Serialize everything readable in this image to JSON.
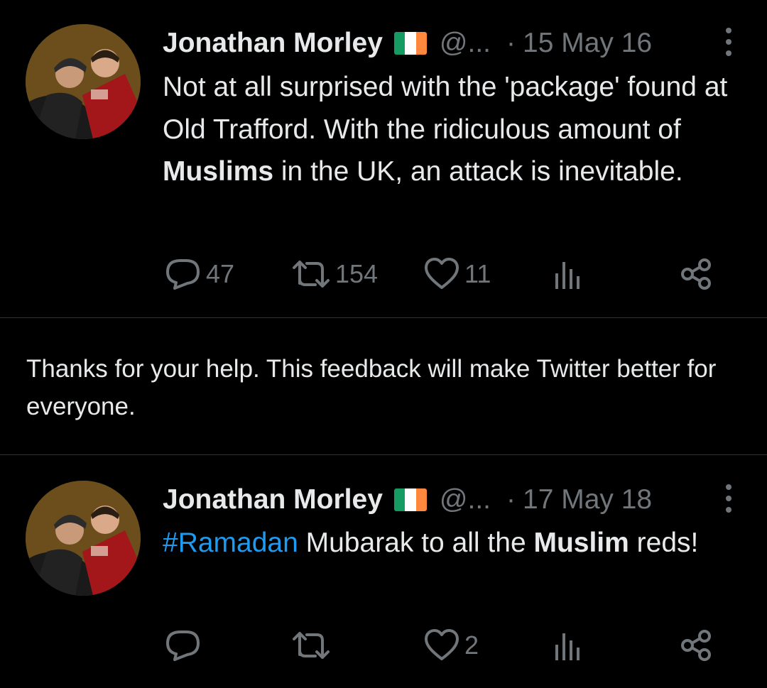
{
  "tweets": [
    {
      "author_name": "Jonathan Morley",
      "handle": "@...",
      "separator": "·",
      "date": "15 May 16",
      "text": {
        "part1": "Not at all surprised with the 'package' found at Old Trafford. With the ridiculous amount of ",
        "bold": "Muslims",
        "part2": " in the UK, an attack is inevitable."
      },
      "replies": "47",
      "retweets": "154",
      "likes": "11"
    },
    {
      "author_name": "Jonathan Morley",
      "handle": "@...",
      "separator": "·",
      "date": "17 May 18",
      "text": {
        "hashtag": "#Ramadan",
        "part1": " Mubarak to all the ",
        "bold": "Muslim",
        "part2": " reds!"
      },
      "replies": "",
      "retweets": "",
      "likes": "2"
    }
  ],
  "feedback_message": "Thanks for your help. This feedback will make Twitter better for everyone.",
  "flag_colors": [
    "#169b62",
    "#ffffff",
    "#ff883e"
  ],
  "accent_color": "#1d9bf0",
  "icons": [
    "reply-icon",
    "retweet-icon",
    "like-icon",
    "analytics-icon",
    "share-icon",
    "more-icon",
    "flag-ireland-icon"
  ]
}
